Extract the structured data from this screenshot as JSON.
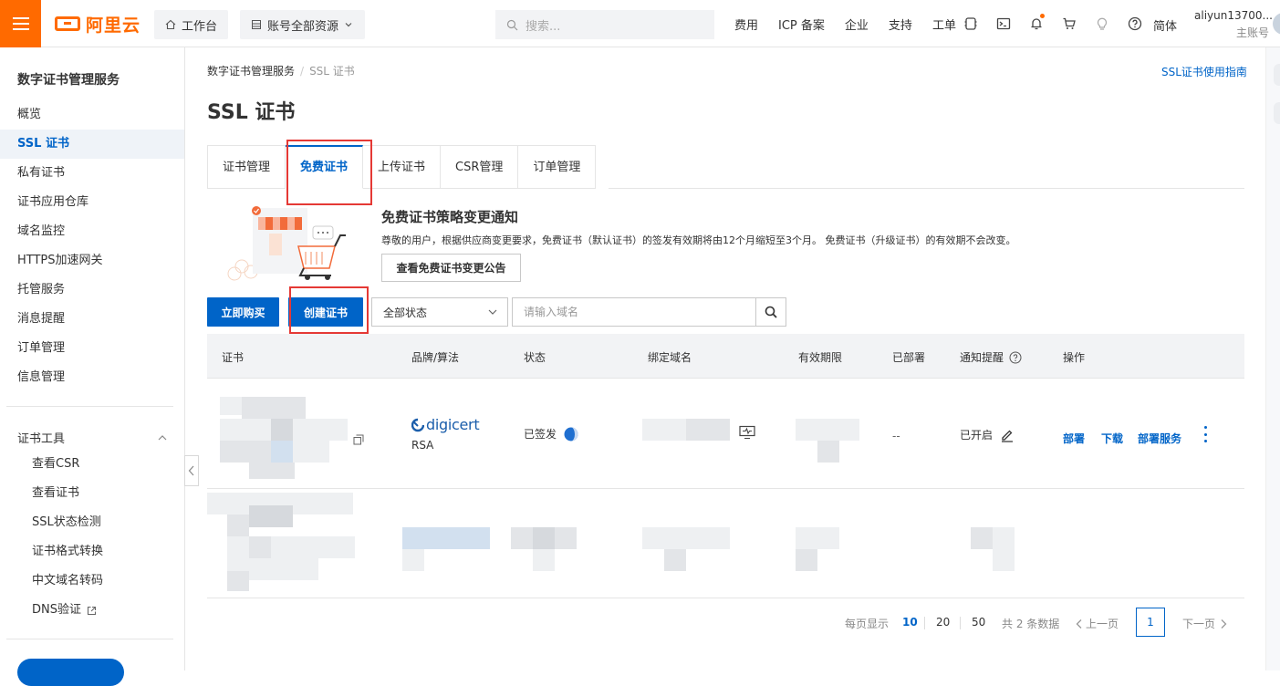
{
  "topbar": {
    "logo_text": "阿里云",
    "workbench": "工作台",
    "resources": "账号全部资源",
    "search_placeholder": "搜索...",
    "links": [
      "费用",
      "ICP 备案",
      "企业",
      "支持",
      "工单"
    ],
    "icons": [
      "app-icon",
      "terminal-icon",
      "bell-icon",
      "cart-icon",
      "lightbulb-icon",
      "help-icon"
    ],
    "lang": "简体",
    "user_name": "aliyun13700...",
    "user_role": "主账号"
  },
  "sidebar": {
    "title": "数字证书管理服务",
    "items": [
      "概览",
      "SSL 证书",
      "私有证书",
      "证书应用仓库",
      "域名监控",
      "HTTPS加速网关",
      "托管服务",
      "消息提醒",
      "订单管理",
      "信息管理"
    ],
    "active_index": 1,
    "tools_group": "证书工具",
    "tools": [
      "查看CSR",
      "查看证书",
      "SSL状态检测",
      "证书格式转换",
      "中文域名转码",
      "DNS验证"
    ]
  },
  "main": {
    "breadcrumb_root": "数字证书管理服务",
    "breadcrumb_current": "SSL 证书",
    "guide_link": "SSL证书使用指南",
    "title": "SSL 证书",
    "tabs": [
      "证书管理",
      "免费证书",
      "上传证书",
      "CSR管理",
      "订单管理"
    ],
    "active_tab": 1,
    "notice": {
      "title": "免费证书策略变更通知",
      "text": "尊敬的用户，根据供应商变更要求，免费证书（默认证书）的签发有效期将由12个月缩短至3个月。 免费证书（升级证书）的有效期不会改变。",
      "button": "查看免费证书变更公告"
    },
    "actions": {
      "buy": "立即购买",
      "create": "创建证书",
      "status_select": "全部状态",
      "domain_placeholder": "请输入域名"
    },
    "table": {
      "headers": [
        "证书",
        "品牌/算法",
        "状态",
        "绑定域名",
        "有效期限",
        "已部署",
        "通知提醒",
        "操作"
      ],
      "row1": {
        "brand": "digicert",
        "algorithm": "RSA",
        "status": "已签发",
        "deployed": "--",
        "notify": "已开启",
        "ops": [
          "部署",
          "下载",
          "部署服务"
        ]
      }
    },
    "pager": {
      "per_page_label": "每页显示",
      "sizes": [
        "10",
        "20",
        "50"
      ],
      "active_size": "10",
      "total": "共 2 条数据",
      "prev": "上一页",
      "current_page": "1",
      "next": "下一页"
    }
  },
  "colors": {
    "accent": "#0064c8",
    "brand": "#ff6a00",
    "highlight": "#e53935"
  }
}
